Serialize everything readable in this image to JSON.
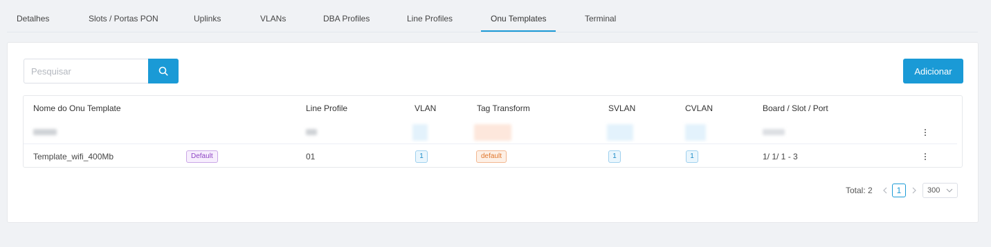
{
  "tabs": [
    {
      "label": "Detalhes"
    },
    {
      "label": "Slots / Portas PON"
    },
    {
      "label": "Uplinks"
    },
    {
      "label": "VLANs"
    },
    {
      "label": "DBA Profiles"
    },
    {
      "label": "Line Profiles"
    },
    {
      "label": "Onu Templates"
    },
    {
      "label": "Terminal"
    }
  ],
  "active_tab": "Onu Templates",
  "search": {
    "placeholder": "Pesquisar",
    "value": ""
  },
  "add_label": "Adicionar",
  "table": {
    "headers": [
      "Nome do Onu Template",
      "Line Profile",
      "VLAN",
      "Tag Transform",
      "SVLAN",
      "CVLAN",
      "Board / Slot / Port"
    ],
    "rows": [
      {
        "name": "",
        "badge": "",
        "line_profile": "",
        "vlan": "",
        "tag_transform": "",
        "svlan": "",
        "cvlan": "",
        "board": "",
        "redacted": true
      },
      {
        "name": "Template_wifi_400Mb",
        "badge": "Default",
        "line_profile": "01",
        "vlan": "1",
        "tag_transform": "default",
        "svlan": "1",
        "cvlan": "1",
        "board": "1/ 1/ 1 - 3",
        "redacted": false
      }
    ]
  },
  "pagination": {
    "total_label": "Total: 2",
    "current_page": "1",
    "page_size": "300"
  },
  "colors": {
    "accent": "#1a9ad6",
    "badge_purple": "#8e44c4",
    "tag_orange": "#e0762c"
  },
  "icons": [
    "search-icon",
    "more-vertical-icon",
    "chevron-left-icon",
    "chevron-right-icon",
    "chevron-down-icon"
  ]
}
